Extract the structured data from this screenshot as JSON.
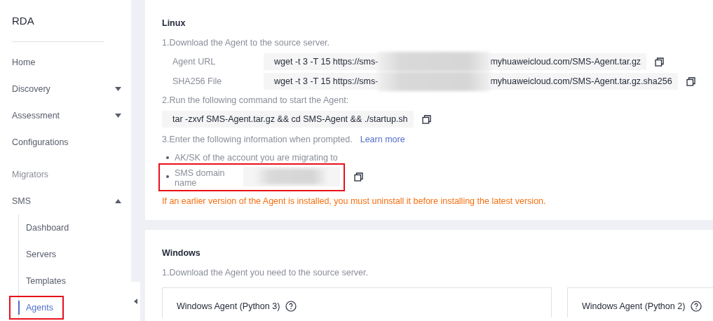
{
  "sidebar": {
    "title": "RDA",
    "items": [
      {
        "kind": "item",
        "label": "Home"
      },
      {
        "kind": "group",
        "label": "Discovery",
        "expanded": false
      },
      {
        "kind": "group",
        "label": "Assessment",
        "expanded": false
      },
      {
        "kind": "item",
        "label": "Configurations"
      },
      {
        "kind": "section",
        "label": "Migrators"
      },
      {
        "kind": "group",
        "label": "SMS",
        "expanded": true,
        "children": [
          {
            "label": "Dashboard",
            "selected": false,
            "highlighted": false
          },
          {
            "label": "Servers",
            "selected": false,
            "highlighted": false
          },
          {
            "label": "Templates",
            "selected": false,
            "highlighted": false
          },
          {
            "label": "Agents",
            "selected": true,
            "highlighted": true
          }
        ]
      }
    ]
  },
  "linux": {
    "title": "Linux",
    "step1": "1.Download the Agent to the source server.",
    "downloads": [
      {
        "label": "Agent URL",
        "value_start": "wget -t 3 -T 15 https://sms-",
        "redacted": true,
        "value_end": "myhuaweicloud.com/SMS-Agent.tar.gz"
      },
      {
        "label": "SHA256 File",
        "value_start": "wget -t 3 -T 15 https://sms-",
        "redacted": true,
        "value_end": "myhuaweicloud.com/SMS-Agent.tar.gz.sha256"
      }
    ],
    "step2": "2.Run the following command to start the Agent:",
    "command": "tar -zxvf SMS-Agent.tar.gz && cd SMS-Agent && ./startup.sh",
    "step3": "3.Enter the following information when prompted.",
    "learn_more": "Learn more",
    "bullets": [
      {
        "kind": "text",
        "label": "AK/SK of the account you are migrating to",
        "highlighted": false
      },
      {
        "kind": "field",
        "label": "SMS domain name",
        "redacted": true,
        "highlighted": true
      }
    ],
    "warning": "If an earlier version of the Agent is installed, you must uninstall it before installing the latest version."
  },
  "windows": {
    "title": "Windows",
    "step1": "1.Download the Agent you need to the source server.",
    "agents": [
      {
        "label": "Windows Agent (Python 3)"
      },
      {
        "label": "Windows Agent (Python 2)"
      }
    ]
  }
}
